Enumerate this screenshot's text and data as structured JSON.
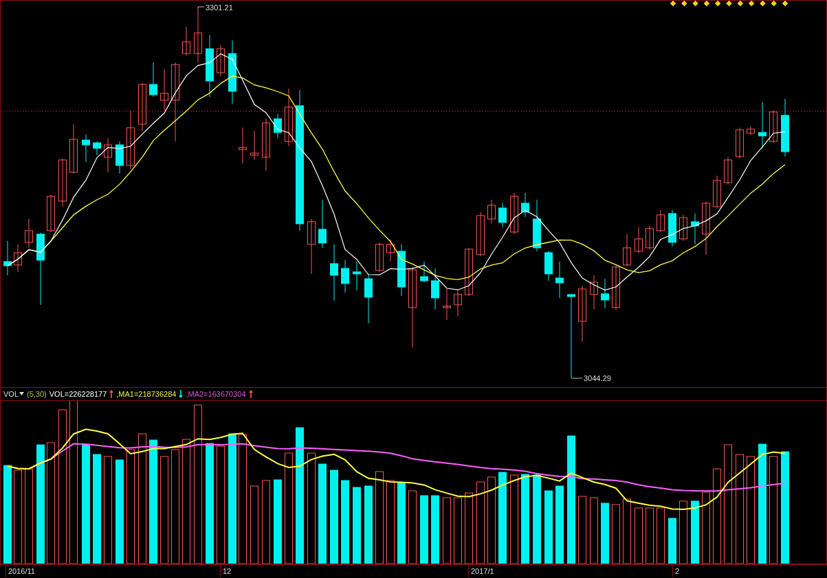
{
  "price_chart": {
    "high_label": "3301.21",
    "low_label": "3044.29"
  },
  "volume_header": {
    "indicator": "VOL",
    "params": "(5,30)",
    "series": [
      {
        "label": "VOL=226228177",
        "color": "#ffffff",
        "arrow": {
          "kind": "up"
        }
      },
      {
        "label": ",MA1=218736284",
        "color": "#f0f050",
        "arrow": {
          "kind": "down"
        }
      },
      {
        "label": ",MA2=163670304",
        "color": "#e050e0",
        "arrow": {
          "kind": "up"
        }
      }
    ]
  },
  "x_axis": [
    "2016/11",
    "12",
    "2017/1",
    "2"
  ]
}
